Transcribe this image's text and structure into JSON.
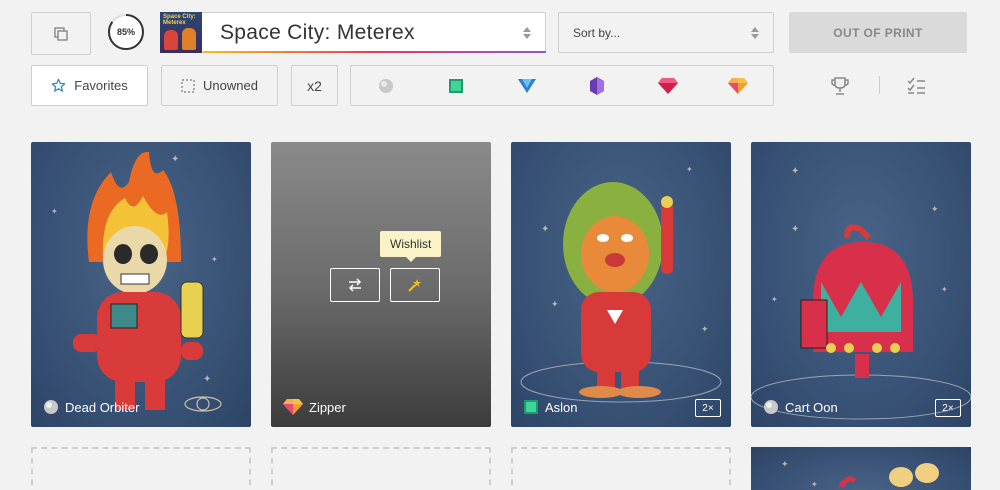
{
  "header": {
    "progress_label": "85%",
    "progress_value": 0.85,
    "set_name": "Space City: Meterex",
    "set_thumb_text": "Space City: Meterex",
    "sort_placeholder": "Sort by...",
    "out_of_print_label": "OUT OF PRINT"
  },
  "filters": {
    "favorites_label": "Favorites",
    "unowned_label": "Unowned",
    "x2_label": "x2",
    "rarities": [
      {
        "name": "common",
        "color": "#b8b8b8"
      },
      {
        "name": "uncommon",
        "color": "#2fc08a"
      },
      {
        "name": "rare",
        "color": "#3aa0e8"
      },
      {
        "name": "epic",
        "color": "#8a5ad0"
      },
      {
        "name": "legendary",
        "color": "#e83a6a"
      },
      {
        "name": "special",
        "color": "#f0a030"
      }
    ]
  },
  "cards": [
    {
      "name": "Dead Orbiter",
      "rarity": "common",
      "doubled": false
    },
    {
      "name": "Zipper",
      "rarity": "special",
      "doubled": false,
      "tooltip": "Wishlist"
    },
    {
      "name": "Aslon",
      "rarity": "uncommon",
      "doubled": true,
      "double_label": "2×"
    },
    {
      "name": "Cart Oon",
      "rarity": "common",
      "doubled": true,
      "double_label": "2×"
    }
  ]
}
